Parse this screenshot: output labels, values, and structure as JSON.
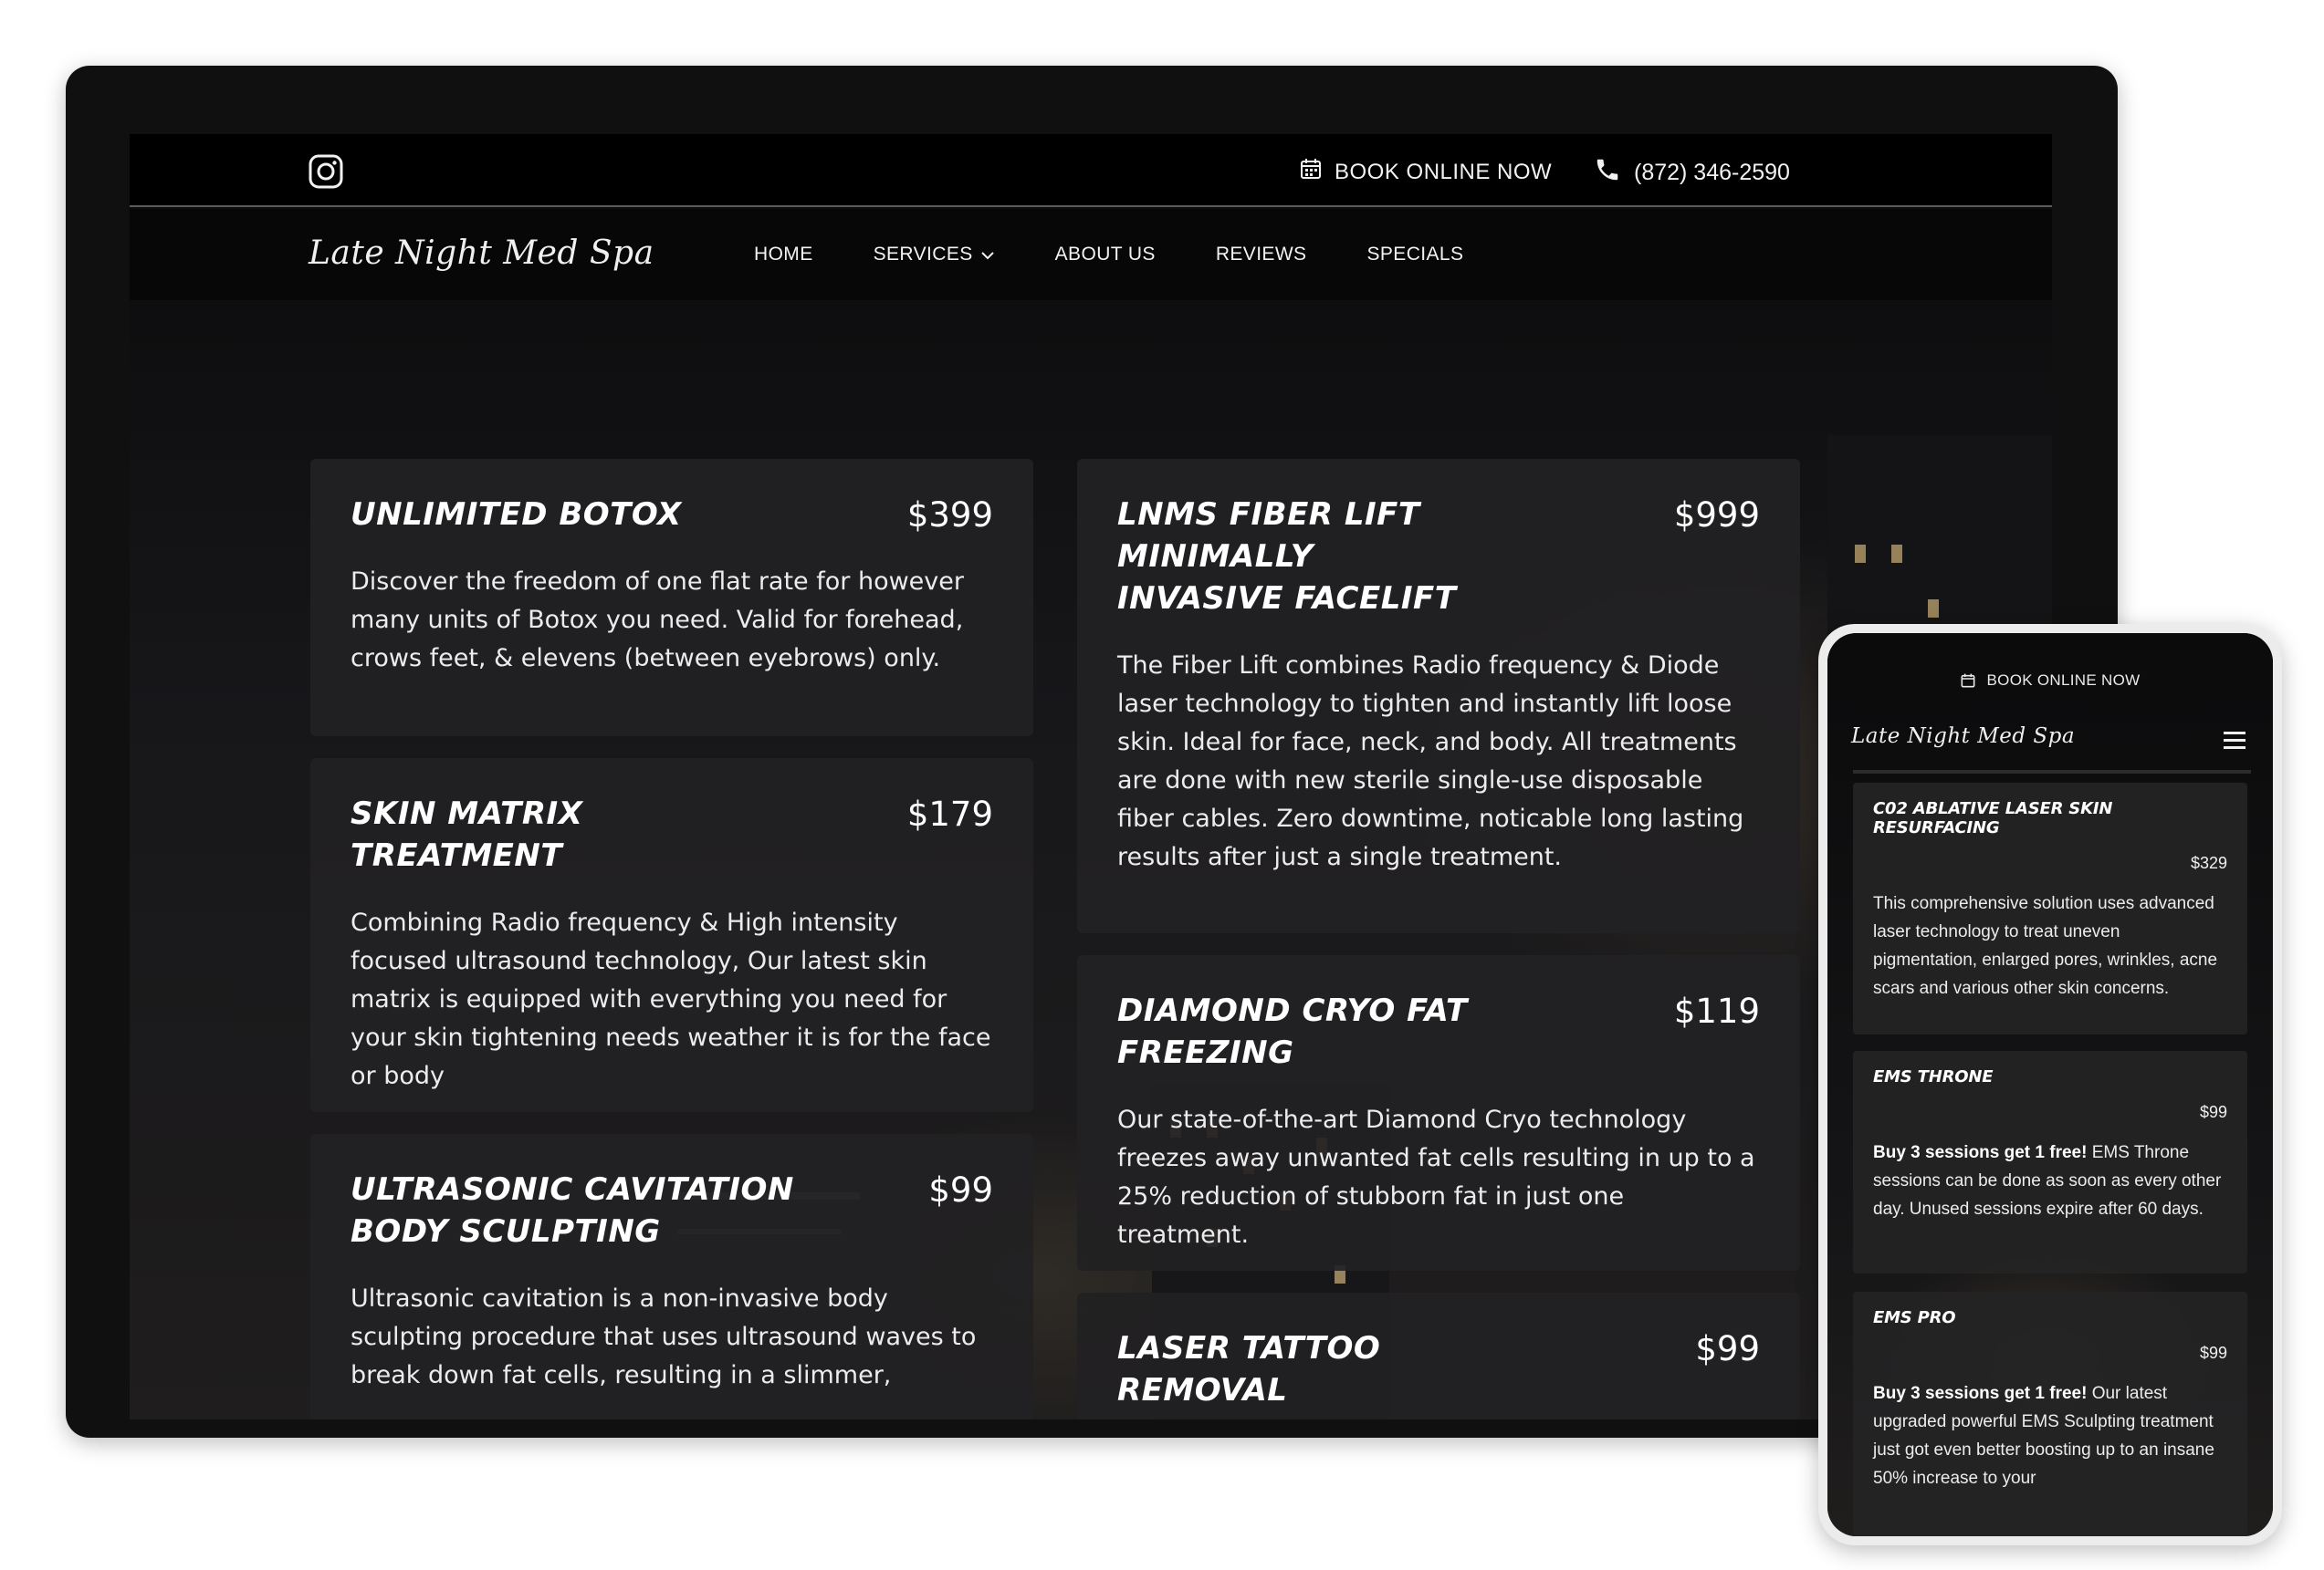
{
  "desktop": {
    "topbar": {
      "instagram_icon": "instagram-icon",
      "book_label": "BOOK ONLINE NOW",
      "book_icon": "calendar-icon",
      "phone_icon": "phone-icon",
      "phone_number": "(872) 346-2590"
    },
    "nav": {
      "logo": "Late Night Med Spa",
      "items": [
        "HOME",
        "SERVICES",
        "ABOUT US",
        "REVIEWS",
        "SPECIALS"
      ]
    },
    "cards": [
      {
        "title": "UNLIMITED BOTOX",
        "price": "$399",
        "description": "Discover the freedom of one flat rate for however many units of Botox you need. Valid for forehead, crows feet, & elevens (between eyebrows) only."
      },
      {
        "title": "SKIN MATRIX TREATMENT",
        "price": "$179",
        "description": "Combining Radio frequency & High intensity focused ultrasound technology, Our latest skin matrix is equipped with everything you need for your skin tightening needs weather it is for the face or body"
      },
      {
        "title": "ULTRASONIC CAVITATION BODY SCULPTING",
        "price": "$99",
        "description": "Ultrasonic cavitation is a non-invasive body sculpting procedure that uses ultrasound waves to break down fat cells, resulting in a slimmer,"
      },
      {
        "title": "LNMS FIBER LIFT MINIMALLY INVASIVE FACELIFT",
        "price": "$999",
        "description": "The Fiber Lift combines Radio frequency & Diode laser technology to tighten and instantly lift loose skin. Ideal for face, neck, and body. All treatments are done with new sterile single-use disposable fiber cables. Zero downtime, noticable long lasting results after just a single treatment."
      },
      {
        "title": "DIAMOND CRYO FAT FREEZING",
        "price": "$119",
        "description": "Our state-of-the-art Diamond Cryo technology freezes away unwanted fat cells resulting in up to a 25% reduction of stubborn fat in just one treatment."
      },
      {
        "title": "LASER TATTOO REMOVAL",
        "price": "$99",
        "description": ""
      }
    ]
  },
  "mobile": {
    "book_label": "BOOK ONLINE NOW",
    "book_icon": "calendar-icon",
    "logo": "Late Night Med Spa",
    "menu_icon": "hamburger-menu-icon",
    "cards": [
      {
        "title": "C02 ABLATIVE LASER SKIN RESURFACING",
        "price": "$329",
        "bold": "",
        "description": "This comprehensive solution uses advanced laser technology to treat uneven pigmentation, enlarged pores, wrinkles, acne scars and various other skin concerns."
      },
      {
        "title": "EMS THRONE",
        "price": "$99",
        "bold": "Buy 3 sessions get 1 free!",
        "description": " EMS Throne sessions can be done as soon as every other day. Unused sessions expire after 60 days."
      },
      {
        "title": "EMS PRO",
        "price": "$99",
        "bold": "Buy 3 sessions get 1 free!",
        "description": " Our latest upgraded powerful EMS Sculpting treatment just got even better boosting up to an insane 50% increase to your"
      }
    ]
  }
}
